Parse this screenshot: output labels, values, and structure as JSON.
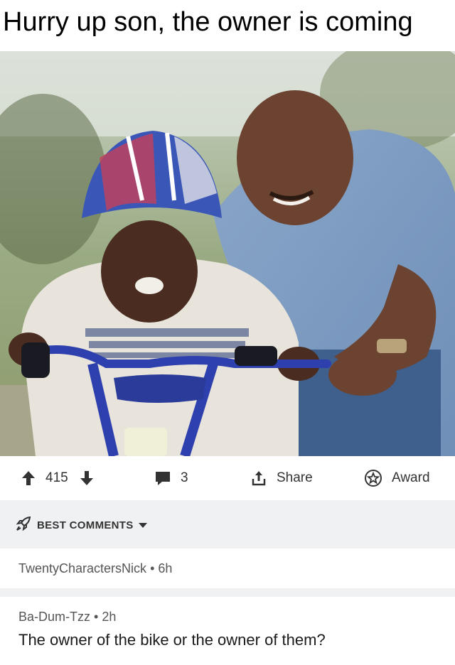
{
  "meme": {
    "caption": "Hurry up son, the owner is coming"
  },
  "actions": {
    "upvote_count": "415",
    "comment_count": "3",
    "share_label": "Share",
    "award_label": "Award"
  },
  "comments_section": {
    "sort_label": "BEST COMMENTS"
  },
  "comments": [
    {
      "author": "TwentyCharactersNick",
      "age": "6h",
      "text": ""
    },
    {
      "author": "Ba-Dum-Tzz",
      "age": "2h",
      "text": "The owner of the bike or the owner of them?"
    }
  ],
  "colors": {
    "accent": "#333333",
    "section_bg": "#f0f1f3"
  }
}
